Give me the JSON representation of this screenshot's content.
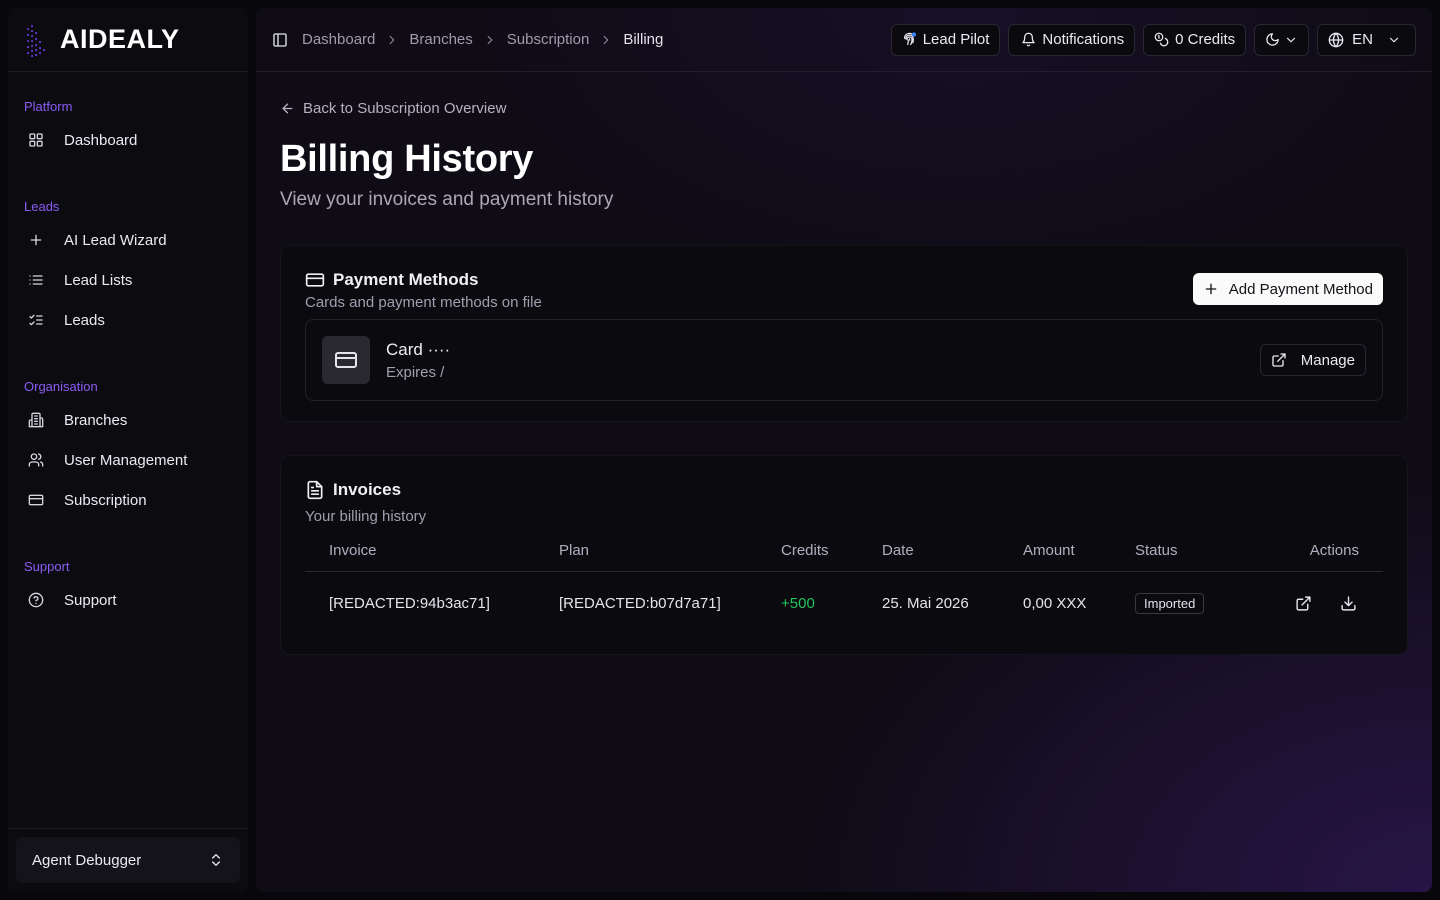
{
  "brand": {
    "name": "AIDEALY"
  },
  "sidebar": {
    "groups": [
      {
        "label": "Platform",
        "items": [
          {
            "label": "Dashboard",
            "icon": "grid-icon"
          }
        ]
      },
      {
        "label": "Leads",
        "items": [
          {
            "label": "AI Lead Wizard",
            "icon": "plus-icon"
          },
          {
            "label": "Lead Lists",
            "icon": "list-icon"
          },
          {
            "label": "Leads",
            "icon": "list-checks-icon"
          }
        ]
      },
      {
        "label": "Organisation",
        "items": [
          {
            "label": "Branches",
            "icon": "building-icon"
          },
          {
            "label": "User Management",
            "icon": "users-icon"
          },
          {
            "label": "Subscription",
            "icon": "credit-card-icon"
          }
        ]
      },
      {
        "label": "Support",
        "items": [
          {
            "label": "Support",
            "icon": "help-circle-icon"
          }
        ]
      }
    ],
    "footer": {
      "label": "Agent Debugger"
    }
  },
  "topbar": {
    "breadcrumbs": [
      "Dashboard",
      "Branches",
      "Subscription",
      "Billing"
    ],
    "lead_pilot": "Lead Pilot",
    "notifications": "Notifications",
    "credits": "0 Credits",
    "language": "EN"
  },
  "page": {
    "back_link": "Back to Subscription Overview",
    "title": "Billing History",
    "subtitle": "View your invoices and payment history"
  },
  "payment_methods": {
    "title": "Payment Methods",
    "subtitle": "Cards and payment methods on file",
    "add_label": "Add Payment Method",
    "method": {
      "name": "Card ····",
      "expires": "Expires /",
      "manage_label": "Manage"
    }
  },
  "invoices": {
    "title": "Invoices",
    "subtitle": "Your billing history",
    "columns": [
      "Invoice",
      "Plan",
      "Credits",
      "Date",
      "Amount",
      "Status",
      "Actions"
    ],
    "rows": [
      {
        "invoice": "[REDACTED:94b3ac71]",
        "plan": "[REDACTED:b07d7a71]",
        "credits": "+500",
        "date": "25. Mai 2026",
        "amount": "0,00 XXX",
        "status": "Imported"
      }
    ]
  },
  "colors": {
    "accent": "#8b5cf6",
    "positive": "#22c55e",
    "background": "#0f0c16"
  }
}
